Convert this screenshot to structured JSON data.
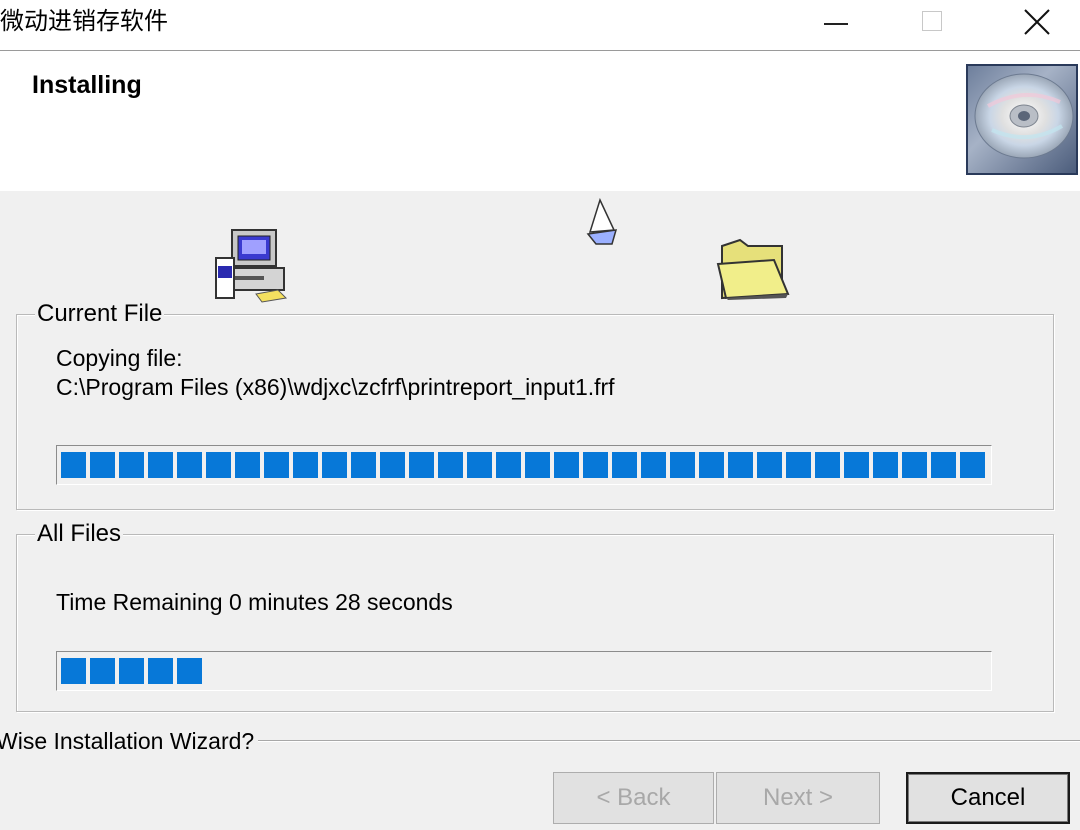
{
  "window": {
    "title": "微动进销存软件",
    "controls": {
      "minimize": "minimize-icon",
      "maximize": "maximize-icon",
      "close": "close-icon"
    }
  },
  "header": {
    "title": "Installing",
    "graphic": "cd-disc-icon"
  },
  "animation": {
    "source_icon": "computer-icon",
    "moving_icon": "flying-paper-icon",
    "target_icon": "folder-icon"
  },
  "current_file": {
    "legend": "Current File",
    "status": "Copying file:",
    "path": "C:\\Program Files (x86)\\wdjxc\\zcfrf\\printreport_input1.frf",
    "progress": 1.0
  },
  "all_files": {
    "legend": "All Files",
    "time_remaining": "Time Remaining 0 minutes 28 seconds",
    "progress": 0.155
  },
  "footer": {
    "brand": "Wise Installation Wizard?"
  },
  "buttons": {
    "back": "< Back",
    "next": "Next >",
    "cancel": "Cancel"
  },
  "colors": {
    "progress": "#0778d8",
    "dialog_bg": "#f0f0f0",
    "header_bg": "#ffffff"
  }
}
